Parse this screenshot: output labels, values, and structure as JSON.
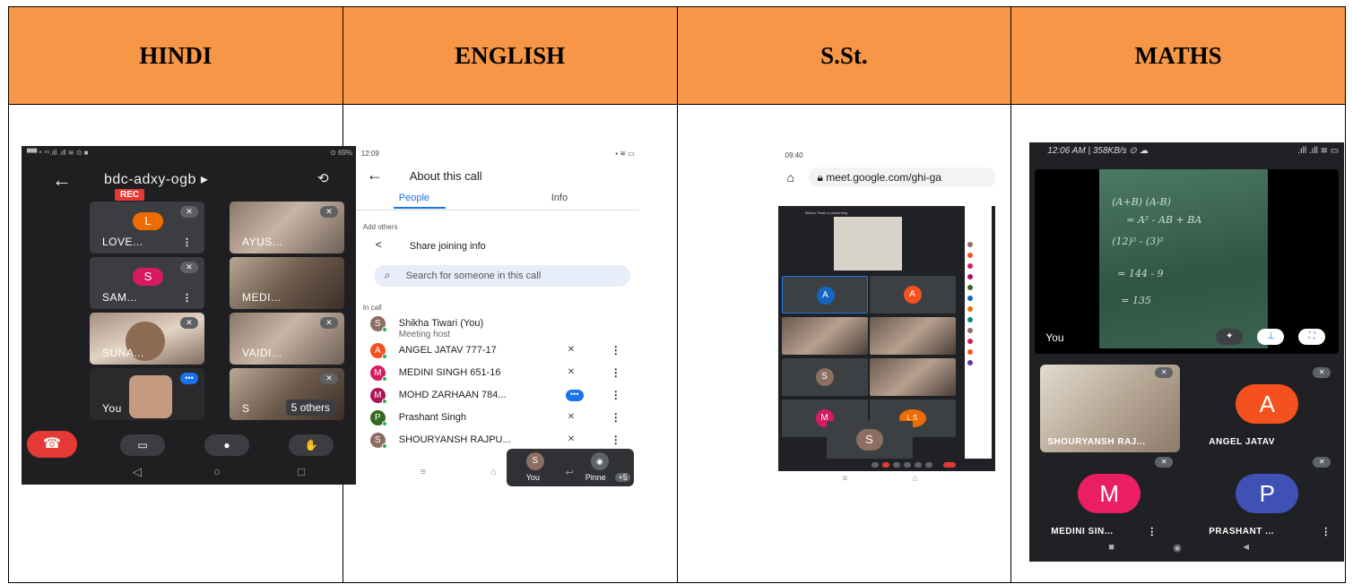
{
  "headers": [
    "HINDI",
    "ENGLISH",
    "S.St.",
    "MATHS"
  ],
  "hindi": {
    "status_left": "▀▀ ᵃ ⁴⁶.ıll .ıll ≋ ⊙ ■",
    "status_right": "⊙ 69%",
    "meeting_code": "bdc-adxy-ogb ▸",
    "rec_label": "REC",
    "tiles": [
      {
        "name": "LOVE...",
        "avatar": "L",
        "color": "#ef6c00"
      },
      {
        "name": "AYUS...",
        "avatar": "",
        "color": ""
      },
      {
        "name": "SAM...",
        "avatar": "S",
        "color": "#d81b60"
      },
      {
        "name": "MEDI...",
        "avatar": "",
        "color": ""
      },
      {
        "name": "SUNA...",
        "avatar": "",
        "color": ""
      },
      {
        "name": "VAIDI...",
        "avatar": "",
        "color": ""
      },
      {
        "name": "You",
        "avatar": "",
        "color": ""
      },
      {
        "name": "S",
        "avatar": "",
        "color": ""
      }
    ],
    "others_badge": "5 others"
  },
  "english": {
    "status_time": "12:09",
    "title": "About this call",
    "tab_people": "People",
    "tab_info": "Info",
    "add_others": "Add others",
    "share_label": "Share joining info",
    "search_placeholder": "Search for someone in this call",
    "in_call": "In call",
    "participants": [
      {
        "initial": "S",
        "name": "Shikha Tiwari (You)",
        "role": "Meeting host",
        "color": "#8d6e63"
      },
      {
        "initial": "A",
        "name": "ANGEL JATAV 777-17",
        "role": "",
        "color": "#f4511e"
      },
      {
        "initial": "M",
        "name": "MEDINI SINGH 651-16",
        "role": "",
        "color": "#d81b60"
      },
      {
        "initial": "M",
        "name": "MOHD ZARHAAN 784...",
        "role": "",
        "color": "#ad1457"
      },
      {
        "initial": "P",
        "name": "Prashant Singh",
        "role": "",
        "color": "#33691e"
      },
      {
        "initial": "S",
        "name": "SHOURYANSH RAJPU...",
        "role": "",
        "color": "#8d6e63"
      }
    ],
    "float_you": "You",
    "float_pinned": "Pinne",
    "float_more": "+5"
  },
  "sst": {
    "status_time": "09:40",
    "url": "meet.google.com/ghi-ga",
    "presenting_text": "Shikha Tiwari is presenting",
    "tiles": [
      {
        "avatar": "A",
        "color": "#1565c0"
      },
      {
        "avatar": "A",
        "color": "#f4511e"
      },
      {
        "avatar": "",
        "color": ""
      },
      {
        "avatar": "",
        "color": ""
      },
      {
        "avatar": "S",
        "color": "#8d6e63"
      },
      {
        "avatar": "",
        "color": ""
      },
      {
        "avatar": "M",
        "color": "#d81b60"
      },
      {
        "avatar": "L S",
        "color": "#ef6c00"
      },
      {
        "avatar": "S",
        "color": "#8d6e63"
      }
    ]
  },
  "maths": {
    "status_left": "12:06 AM | 358KB/s ⊙ ☁",
    "status_right": ".ıll .ıll ≋ ▭",
    "you_label": "You",
    "tiles": [
      {
        "name": "SHOURYANSH RAJ...",
        "avatar": "",
        "color": ""
      },
      {
        "name": "ANGEL JATAV",
        "avatar": "A",
        "color": "#f4511e"
      },
      {
        "name": "MEDINI SIN...",
        "avatar": "M",
        "color": "#e91e63"
      },
      {
        "name": "PRASHANT ...",
        "avatar": "P",
        "color": "#3f51b5"
      }
    ]
  }
}
